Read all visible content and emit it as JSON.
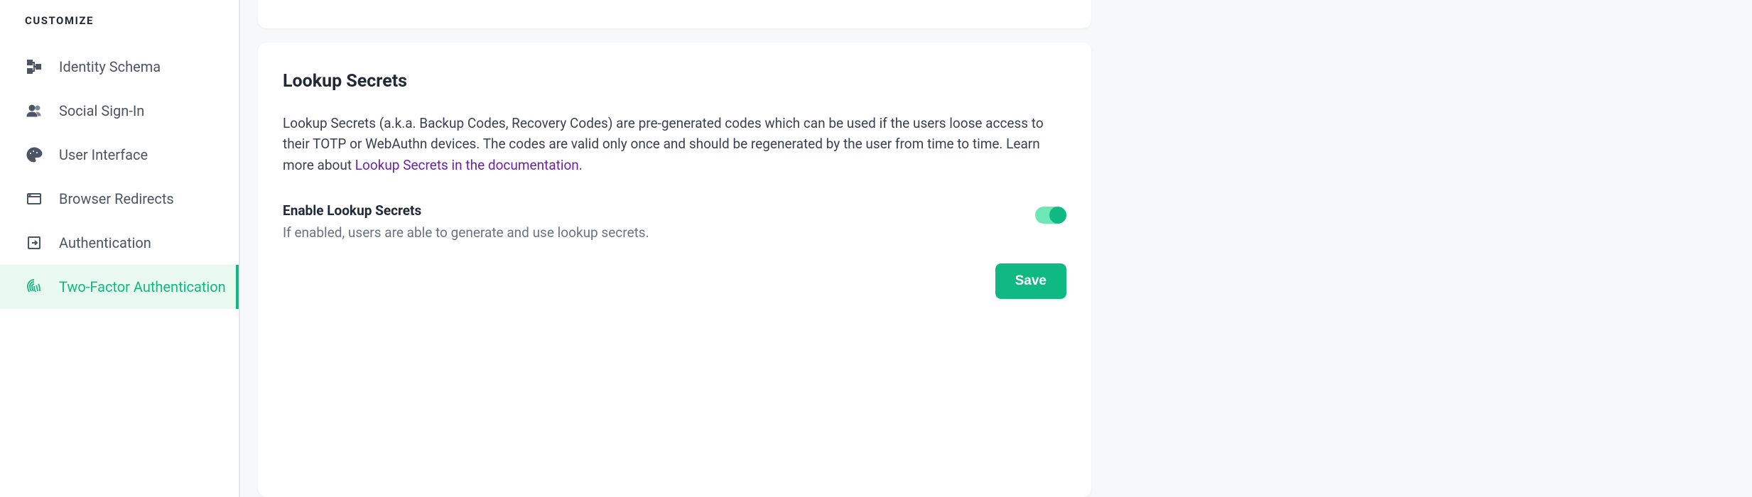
{
  "sidebar": {
    "section": "CUSTOMIZE",
    "items": [
      {
        "label": "Identity Schema"
      },
      {
        "label": "Social Sign-In"
      },
      {
        "label": "User Interface"
      },
      {
        "label": "Browser Redirects"
      },
      {
        "label": "Authentication"
      },
      {
        "label": "Two-Factor Authentication"
      }
    ]
  },
  "card": {
    "title": "Lookup Secrets",
    "desc_1": "Lookup Secrets (a.k.a. Backup Codes, Recovery Codes) are pre-generated codes which can be used if the users loose access to their TOTP or WebAuthn devices. The codes are valid only once and should be regenerated by the user from time to time. Learn more about ",
    "desc_link": "Lookup Secrets in the documentation",
    "desc_2": ".",
    "setting_label": "Enable Lookup Secrets",
    "setting_help": "If enabled, users are able to generate and use lookup secrets.",
    "toggle_on": true,
    "save": "Save"
  }
}
